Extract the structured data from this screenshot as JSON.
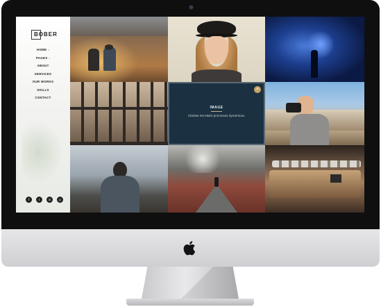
{
  "site": {
    "logo": "BOBER",
    "nav": [
      {
        "label": "HOME",
        "caret": "›"
      },
      {
        "label": "PAGES",
        "caret": "›"
      },
      {
        "label": "ABOUT",
        "caret": ""
      },
      {
        "label": "SERVICES",
        "caret": ""
      },
      {
        "label": "OUR WORKS",
        "caret": ""
      },
      {
        "label": "SKILLS",
        "caret": ""
      },
      {
        "label": "CONTACT",
        "caret": ""
      }
    ],
    "socials": [
      "f",
      "t",
      "in",
      "p"
    ]
  },
  "gallery": {
    "hover": {
      "title": "IMAGE",
      "text": "Claritas est etiam processus dynamicus.",
      "plus": "+"
    }
  },
  "device": {
    "brand_icon": "apple-logo-icon"
  }
}
